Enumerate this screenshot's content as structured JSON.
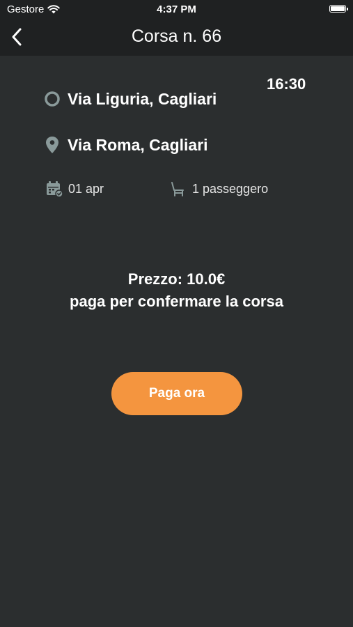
{
  "status_bar": {
    "carrier": "Gestore",
    "time": "4:37 PM"
  },
  "nav": {
    "title": "Corsa n. 66"
  },
  "ride": {
    "departure_time": "16:30",
    "from_address": "Via Liguria, Cagliari",
    "to_address": "Via Roma, Cagliari",
    "date": "01 apr",
    "passengers": "1 passeggero"
  },
  "payment": {
    "price_text": "Prezzo: 10.0€",
    "instruction": "paga per confermare la corsa",
    "button_label": "Paga ora"
  },
  "colors": {
    "background": "#2b2e2f",
    "bar": "#1f2122",
    "accent": "#f4953f",
    "icon": "#8a9a9a"
  },
  "icons": [
    "wifi-icon",
    "battery-icon",
    "back-chevron-icon",
    "origin-circle-icon",
    "destination-pin-icon",
    "calendar-icon",
    "seat-icon"
  ]
}
